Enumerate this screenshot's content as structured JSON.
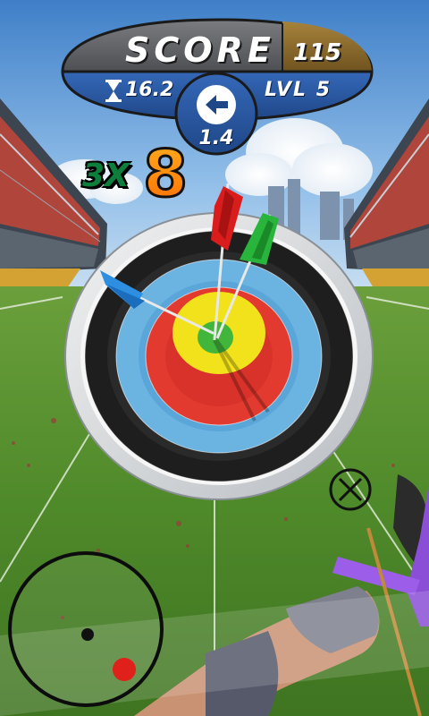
{
  "hud": {
    "score_label": "SCORE",
    "score_value": "115",
    "timer_value": "16.2",
    "level_label": "LVL 5",
    "wind_value": "1.4",
    "wind_direction": "left",
    "multiplier": "3X",
    "last_shot_points": "8",
    "colors": {
      "banner_gray": "#5d5f63",
      "banner_blue": "#2a55a0",
      "score_bar": "#8b6a2c",
      "multiplier": "#0e7e3c",
      "points": "#ff8a00"
    }
  },
  "icons": {
    "timer": "hourglass-icon",
    "wind": "arrow-left-icon",
    "aim": "crosshair-icon"
  },
  "target": {
    "rings_outer_to_inner": [
      "white",
      "black",
      "blue",
      "red",
      "gold"
    ],
    "arrows": [
      {
        "fletching_color": "#2e8fe0"
      },
      {
        "fletching_color": "#d91d1d"
      },
      {
        "fletching_color": "#29b43b"
      }
    ]
  },
  "controls": {
    "joystick": "aim-joystick",
    "joystick_marker_color": "#e0201b"
  }
}
